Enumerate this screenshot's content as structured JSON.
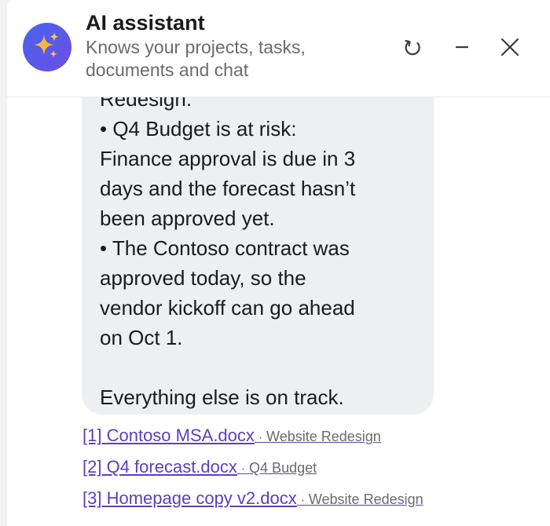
{
  "header": {
    "title": "AI assistant",
    "subtitle": "Knows your projects, tasks, documents and chat",
    "icons": {
      "avatar": "sparkles-icon",
      "refresh": "refresh-icon",
      "minimize": "minimize-icon",
      "close": "close-icon"
    }
  },
  "colors": {
    "avatar_start": "#4a63ee",
    "avatar_end": "#6b4fe4",
    "sparkle": "#f5b642",
    "bubble_bg": "#eeeff2",
    "link": "#5a3fc0"
  },
  "message": {
    "lines": [
      "Redesign.",
      "• Q4 Budget is at risk:",
      "Finance approval is due in 3",
      "days and the forecast hasn’t",
      "been approved yet.",
      "• The Contoso contract was",
      "approved today, so the",
      "vendor kickoff can go ahead",
      "on Oct 1.",
      "",
      "Everything else is on track."
    ]
  },
  "sources": [
    {
      "ref": "[1]",
      "file": "Contoso MSA.docx",
      "separator": "·",
      "project": "Website Redesign"
    },
    {
      "ref": "[2]",
      "file": "Q4 forecast.docx",
      "separator": "·",
      "project": "Q4 Budget"
    },
    {
      "ref": "[3]",
      "file": "Homepage copy v2.docx",
      "separator": "·",
      "project": "Website Redesign"
    }
  ]
}
